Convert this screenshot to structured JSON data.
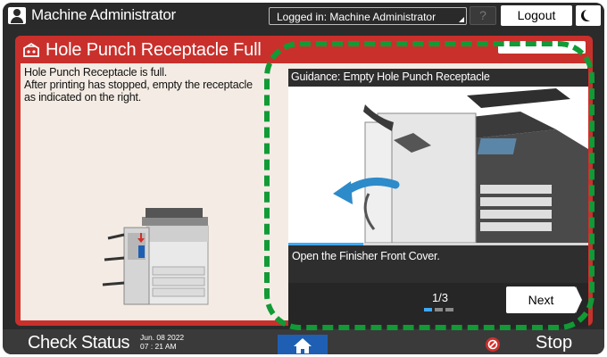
{
  "topbar": {
    "user_label": "Machine Administrator",
    "login_status": "Logged in: Machine Administrator",
    "help_label": "?",
    "logout_label": "Logout",
    "mode_icon": "moon-icon"
  },
  "alert": {
    "title": "Hole Punch Receptacle Full",
    "icon": "hole-punch-alert-icon",
    "message_lines": [
      "Hole Punch Receptacle is full.",
      "After printing has stopped, empty the receptacle",
      "as indicated on the right."
    ],
    "color": "#c9302c"
  },
  "guidance": {
    "title": "Guidance: Empty Hole Punch Receptacle",
    "step_text": "Open the Finisher Front Cover.",
    "page_indicator": "1/3",
    "current_step": 1,
    "total_steps": 3,
    "progress": 0.25,
    "next_label": "Next",
    "accent": "#3fa9f5"
  },
  "bottombar": {
    "check_status_label": "Check Status",
    "date": "Jun. 08 2022",
    "time": "07 : 21 AM",
    "home_icon": "home-icon",
    "stop_label": "Stop",
    "stop_color": "#d12f2a"
  },
  "highlight_color": "#119a36"
}
